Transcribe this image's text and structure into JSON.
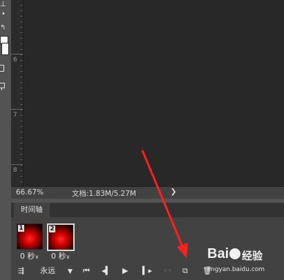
{
  "toolbar": {
    "icons": [
      "move-icon",
      "dot-icon",
      "swap-colors-icon",
      "foreground-color-swatch",
      "background-color-swatch",
      "quick-mask-icon",
      "screen-mode-icon"
    ],
    "colors": {
      "foreground": "#ffffff",
      "background": "#ffffff"
    }
  },
  "ruler": {
    "labels": [
      "6",
      "7",
      "8"
    ]
  },
  "status": {
    "zoom": "66.67%",
    "doc": "文档:1.83M/5.27M",
    "arrow": "❯"
  },
  "timeline": {
    "tab_label": "时间轴",
    "frames": [
      {
        "number": "1",
        "delay": "0 秒",
        "selected": false
      },
      {
        "number": "2",
        "delay": "0 秒",
        "selected": true
      }
    ],
    "loop_label": "永远",
    "controls": [
      "convert-icon",
      "loop-dropdown-icon",
      "first-frame-icon",
      "previous-frame-icon",
      "play-icon",
      "next-frame-icon",
      "tween-icon",
      "duplicate-frame-icon",
      "delete-frame-icon"
    ]
  },
  "colors": {
    "canvas": "#282828",
    "panel": "#424242",
    "annotation": "#ff1f1f"
  },
  "watermark": {
    "brand": "Bai",
    "paw": "du",
    "text": "经验",
    "url": "jingyan.baidu.com"
  }
}
